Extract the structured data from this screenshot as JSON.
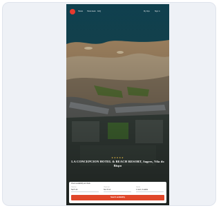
{
  "nav": {
    "links": [
      "Hotels",
      "Hotel deals",
      "FAQ"
    ],
    "right_links": [
      "My trips",
      "Sign in"
    ]
  },
  "hero": {
    "stars": "★★★★★",
    "headline": "LA CONCEPCION HOTEL & BEACH RESORT, Sagres, Vila do Bispo"
  },
  "booking": {
    "title": "Check availability and book",
    "fields": [
      {
        "label": "Check-in",
        "value": "Sat 5 Jul"
      },
      {
        "label": "Check-out",
        "value": "Sun 6 Jul"
      },
      {
        "label": "Guests",
        "value": "1 room, 2 adults"
      }
    ],
    "search_label": "Search availability"
  },
  "colors": {
    "brand": "#e63a2e",
    "button": "#e0472a",
    "sea": "#1b4f5e"
  }
}
